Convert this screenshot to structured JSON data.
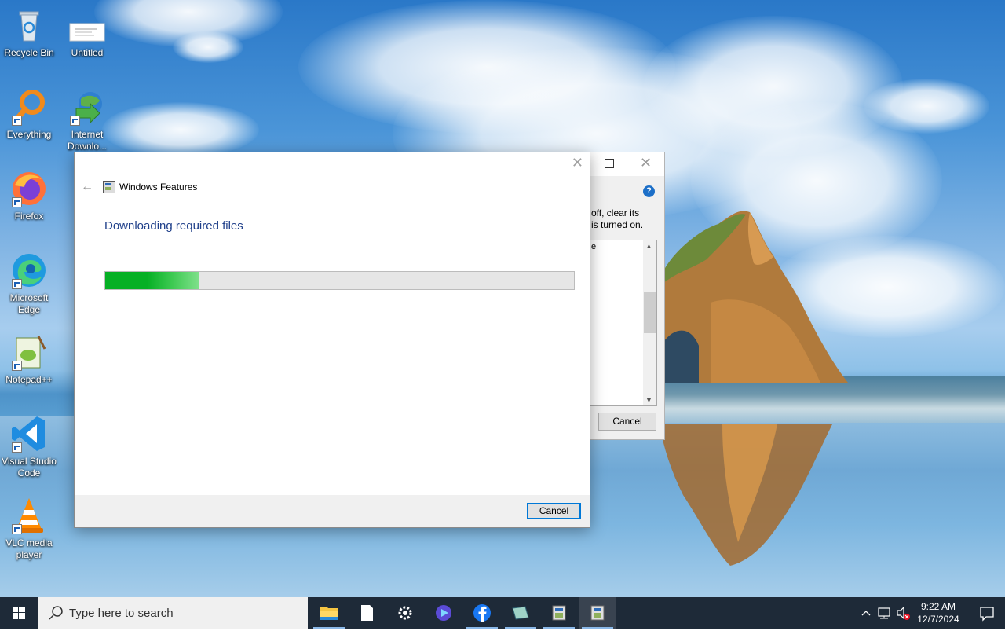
{
  "desktop": {
    "icons": [
      {
        "label": "Recycle Bin"
      },
      {
        "label": "Untitled"
      },
      {
        "label": "Everything"
      },
      {
        "label": "Internet Downlo..."
      },
      {
        "label": "Firefox"
      },
      {
        "label": "Microsoft Edge"
      },
      {
        "label": "Notepad++"
      },
      {
        "label": "Visual Studio Code"
      },
      {
        "label": "VLC media player"
      }
    ]
  },
  "background_dialog": {
    "description_line1": "off, clear its",
    "description_line2": "is turned on.",
    "list_fragment": "e",
    "cancel_label": "Cancel",
    "help_glyph": "?"
  },
  "dialog": {
    "title": "Windows Features",
    "heading": "Downloading required files",
    "progress": 0.2,
    "cancel_label": "Cancel"
  },
  "taskbar": {
    "search_placeholder": "Type here to search",
    "apps": [
      "file-explorer",
      "notepad",
      "settings",
      "clipchamp",
      "facebook",
      "app-5",
      "windows-features-1",
      "windows-features-2"
    ],
    "clock": {
      "time": "9:22 AM",
      "date": "12/7/2024"
    }
  },
  "colors": {
    "accent": "#0078d7",
    "heading": "#1f3f8a",
    "progress_green": "#06b025",
    "taskbar": "#1e2a38"
  }
}
